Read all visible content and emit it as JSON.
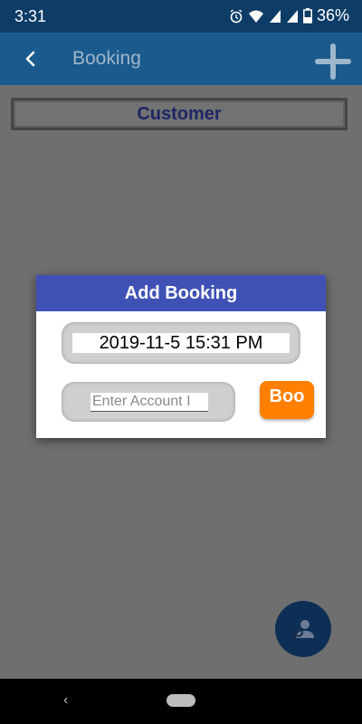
{
  "status_bar": {
    "time": "3:31",
    "battery": "36%"
  },
  "app_bar": {
    "title": "Booking",
    "back_icon": "chevron-left-icon",
    "add_icon": "plus-icon"
  },
  "main": {
    "customer_label": "Customer",
    "fab_icon": "person-search-icon"
  },
  "dialog": {
    "title": "Add Booking",
    "datetime": "2019-11-5 15:31 PM",
    "account_placeholder": "Enter Account I",
    "book_label": "Boo\nk"
  },
  "colors": {
    "status_bar": "#0d3c66",
    "app_bar": "#1b5a8c",
    "dialog_header": "#3f51b5",
    "book_button": "#ff7f00",
    "fab": "#0d2f56"
  }
}
